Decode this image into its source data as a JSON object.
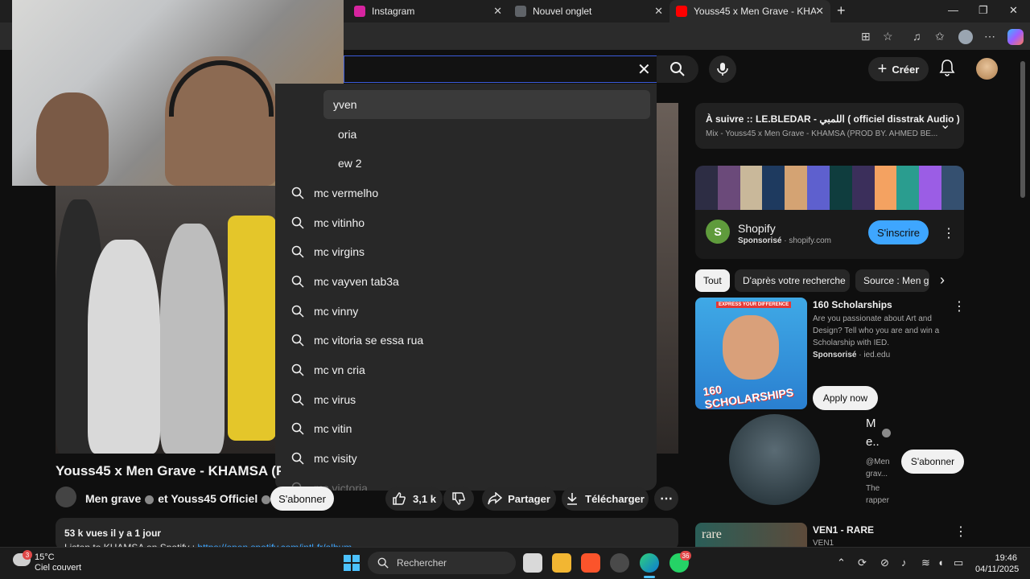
{
  "browser": {
    "tabs": [
      {
        "label": "Instagram",
        "color": "#d6249f"
      },
      {
        "label": "Nouvel onglet",
        "color": "#9aa0a6"
      },
      {
        "label": "Youss45 x Men Grave - KHAMSA",
        "color": "#ff0000"
      }
    ]
  },
  "header": {
    "create_label": "Créer",
    "search_clear": "✕"
  },
  "suggestions": {
    "items": [
      "yven",
      "oria",
      "ew 2",
      "mc vermelho",
      "mc vitinho",
      "mc virgins",
      "mc vayven tab3a",
      "mc vinny",
      "mc vitoria se essa rua",
      "mc vn cria",
      "mc virus",
      "mc vitin",
      "mc visity",
      "mc victoria"
    ]
  },
  "video": {
    "title": "Youss45 x Men Grave - KHAMSA (PR",
    "channel": "Men grave",
    "channel_joiner": "et Youss45 Officiel",
    "subscribe_label": "S'abonner",
    "likes": "3,1 k",
    "share_label": "Partager",
    "download_label": "Télécharger",
    "views": "53 k vues  il y a 1 jour",
    "desc_prefix": "Listen to KHAMSA on Spotify : ",
    "desc_link": "https://open.spotify.com/intl-fr/album"
  },
  "sidebar": {
    "mix": {
      "title": "À suivre :: LE.BLEDAR - اللمبي ( officiel disstrak Audio )",
      "subtitle": "Mix - Youss45 x Men Grave - KHAMSA (PROD BY. AHMED BE..."
    },
    "ad": {
      "name": "Shopify",
      "sponsored": "Sponsorisé",
      "domain": " · shopify.com",
      "cta": "S'inscrire",
      "banner_colors": [
        "#2d2d44",
        "#6b4a7a",
        "#c9b89a",
        "#1e3a5f",
        "#d4a373",
        "#5e60ce",
        "#0f3d3e",
        "#3b2f5b",
        "#f4a261",
        "#2a9d8f",
        "#9b5de5",
        "#355070"
      ]
    },
    "chips": [
      "Tout",
      "D'après votre recherche",
      "Source : Men grave"
    ],
    "rec1": {
      "title": "160 Scholarships",
      "desc": "Are you passionate about Art and Design? Tell who you are and win a Scholarship with IED.",
      "sponsored": "Sponsorisé",
      "domain": " · ied.edu",
      "cta": "Apply now",
      "thumb_tag": "EXPRESS YOUR DIFFERENCE",
      "thumb_big": "160 SCHOLARSHIPS"
    },
    "rec2": {
      "name_line1": "M",
      "name_line2": "e..",
      "handle_1": "@Men",
      "handle_2": "grav...",
      "desc_1": "The",
      "desc_2": "rapper",
      "cta": "S'abonner"
    },
    "rec3": {
      "title": "VEN1 - RARE",
      "channel": "VEN1",
      "thumb_text": "rare"
    }
  },
  "taskbar": {
    "temp": "15°C",
    "condition": "Ciel couvert",
    "weather_badge": "3",
    "search_placeholder": "Rechercher",
    "whatsapp_badge": "36",
    "time": "19:46",
    "date": "04/11/2025"
  }
}
